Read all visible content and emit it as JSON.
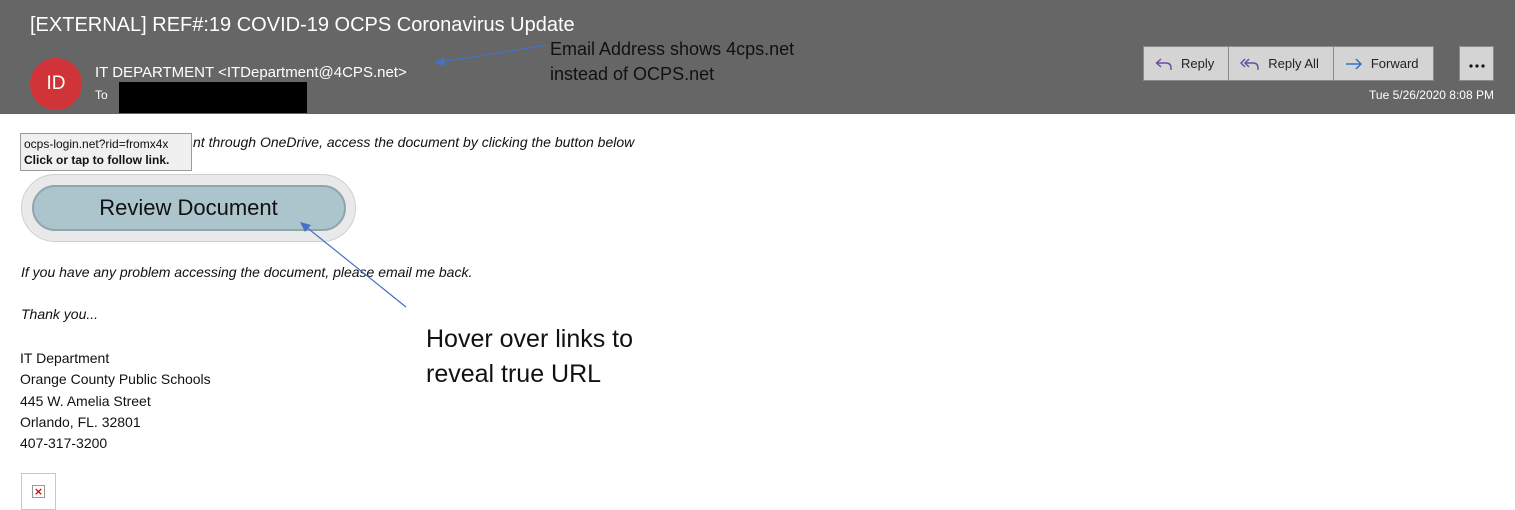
{
  "message": {
    "subject": "[EXTERNAL] REF#:19 COVID-19 OCPS Coronavirus Update",
    "avatar_initials": "ID",
    "avatar_color": "#d13438",
    "sender": "IT DEPARTMENT <ITDepartment@4CPS.net>",
    "to_label": "To",
    "date": "Tue 5/26/2020 8:08 PM"
  },
  "actions": {
    "reply_label": "Reply",
    "reply_all_label": "Reply All",
    "forward_label": "Forward",
    "more_icon": "ellipsis-icon"
  },
  "body": {
    "intro_visible": "nt through OneDrive, access the document by clicking the button below",
    "tooltip_url": "ocps-login.net?rid=fromx4x",
    "tooltip_hint": "Click or tap to follow link.",
    "review_button": "Review Document",
    "problem_line": "If you have any problem accessing the document, please email me back.",
    "thanks_line": "Thank you...",
    "signature": [
      "IT Department",
      "Orange County Public Schools",
      "445 W. Amelia Street",
      "Orlando, FL. 32801",
      "407-317-3200"
    ]
  },
  "annotations": {
    "email_callout": [
      "Email Address shows 4cps.net",
      "instead of OCPS.net"
    ],
    "hover_callout": [
      "Hover over links to",
      "reveal true URL"
    ],
    "arrow_color": "#4472c4"
  },
  "colors": {
    "header_bg": "#666666",
    "button_bg": "#d4d4d4",
    "review_button_bg": "#acc5cc"
  }
}
